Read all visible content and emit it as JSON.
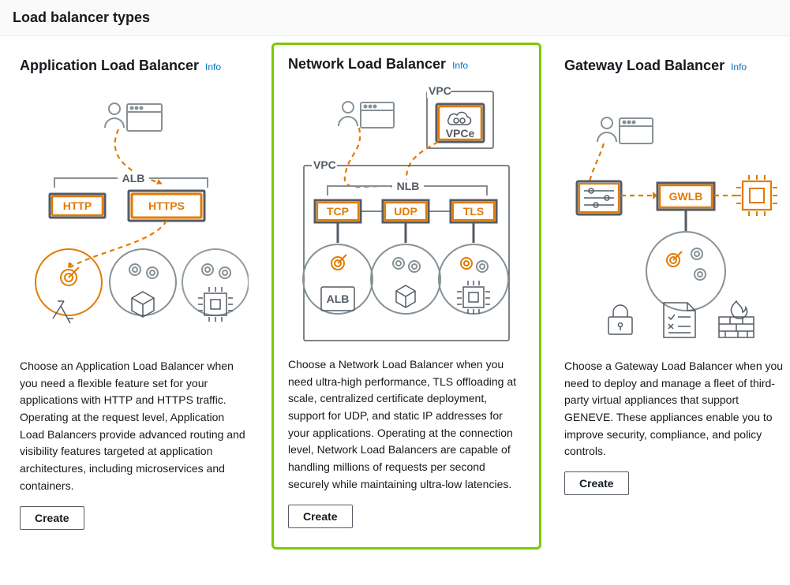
{
  "header": {
    "title": "Load balancer types"
  },
  "cards": {
    "alb": {
      "title": "Application Load Balancer",
      "info": "Info",
      "desc": "Choose an Application Load Balancer when you need a flexible feature set for your applications with HTTP and HTTPS traffic. Operating at the request level, Application Load Balancers provide advanced routing and visibility features targeted at application architectures, including microservices and containers.",
      "create": "Create",
      "diagram": {
        "alb": "ALB",
        "http": "HTTP",
        "https": "HTTPS"
      }
    },
    "nlb": {
      "title": "Network Load Balancer",
      "info": "Info",
      "desc": "Choose a Network Load Balancer when you need ultra-high performance, TLS offloading at scale, centralized certificate deployment, support for UDP, and static IP addresses for your applications. Operating at the connection level, Network Load Balancers are capable of handling millions of requests per second securely while maintaining ultra-low latencies.",
      "create": "Create",
      "diagram": {
        "vpc1_label": "VPC",
        "vpce": "VPCe",
        "vpc2_label": "VPC",
        "nlb": "NLB",
        "tcp": "TCP",
        "udp": "UDP",
        "tls": "TLS",
        "alb": "ALB"
      }
    },
    "gwlb": {
      "title": "Gateway Load Balancer",
      "info": "Info",
      "desc": "Choose a Gateway Load Balancer when you need to deploy and manage a fleet of third-party virtual appliances that support GENEVE. These appliances enable you to improve security, compliance, and policy controls.",
      "create": "Create",
      "diagram": {
        "gwlb": "GWLB"
      }
    }
  }
}
